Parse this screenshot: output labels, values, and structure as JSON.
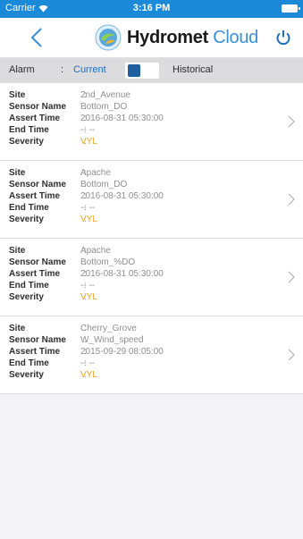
{
  "status_bar": {
    "carrier": "Carrier",
    "time": "3:16 PM"
  },
  "header": {
    "logo_text_main": "Hydromet",
    "logo_text_sub": "Cloud"
  },
  "filter": {
    "alarm_label": "Alarm",
    "separator": ":",
    "current_label": "Current",
    "historical_label": "Historical"
  },
  "labels": {
    "site": "Site",
    "sensor_name": "Sensor Name",
    "assert_time": "Assert Time",
    "end_time": "End Time",
    "severity": "Severity",
    "separator": ":"
  },
  "alarms": [
    {
      "site": "2nd_Avenue",
      "sensor_name": "Bottom_DO",
      "assert_time": "2016-08-31 05:30:00",
      "end_time": "-- --",
      "severity": "VYL"
    },
    {
      "site": "Apache",
      "sensor_name": "Bottom_DO",
      "assert_time": "2016-08-31 05:30:00",
      "end_time": "-- --",
      "severity": "VYL"
    },
    {
      "site": "Apache",
      "sensor_name": "Bottom_%DO",
      "assert_time": "2016-08-31 05:30:00",
      "end_time": "-- --",
      "severity": "VYL"
    },
    {
      "site": "Cherry_Grove",
      "sensor_name": "W_Wind_speed",
      "assert_time": "2015-09-29 08:05:00",
      "end_time": "-- --",
      "severity": "VYL"
    }
  ],
  "colors": {
    "status_bar": "#1a8ad8",
    "accent": "#1f6fb8",
    "severity": "#e9a21c",
    "toggle_knob": "#1f5f9e"
  }
}
